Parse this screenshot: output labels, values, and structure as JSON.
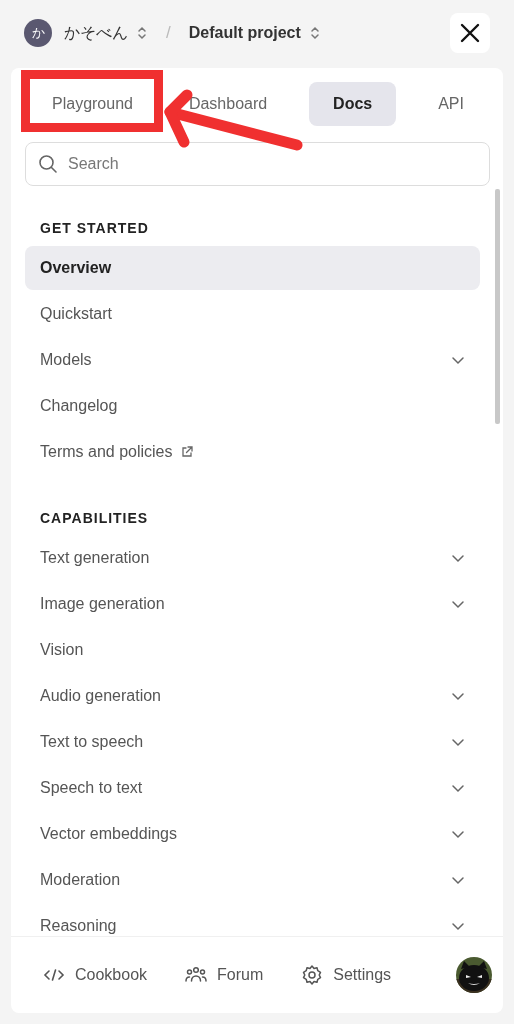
{
  "header": {
    "org_initial": "か",
    "org_name": "かそべん",
    "separator": "/",
    "project_name": "Default project"
  },
  "tabs": [
    {
      "label": "Playground",
      "selected": false
    },
    {
      "label": "Dashboard",
      "selected": false
    },
    {
      "label": "Docs",
      "selected": true
    },
    {
      "label": "API",
      "selected": false
    }
  ],
  "search": {
    "placeholder": "Search"
  },
  "sections": [
    {
      "heading": "GET STARTED",
      "items": [
        {
          "label": "Overview",
          "kind": "page",
          "selected": true
        },
        {
          "label": "Quickstart",
          "kind": "page",
          "selected": false
        },
        {
          "label": "Models",
          "kind": "group",
          "selected": false
        },
        {
          "label": "Changelog",
          "kind": "page",
          "selected": false
        },
        {
          "label": "Terms and policies",
          "kind": "external",
          "selected": false
        }
      ]
    },
    {
      "heading": "CAPABILITIES",
      "items": [
        {
          "label": "Text generation",
          "kind": "group",
          "selected": false
        },
        {
          "label": "Image generation",
          "kind": "group",
          "selected": false
        },
        {
          "label": "Vision",
          "kind": "page",
          "selected": false
        },
        {
          "label": "Audio generation",
          "kind": "group",
          "selected": false
        },
        {
          "label": "Text to speech",
          "kind": "group",
          "selected": false
        },
        {
          "label": "Speech to text",
          "kind": "group",
          "selected": false
        },
        {
          "label": "Vector embeddings",
          "kind": "group",
          "selected": false
        },
        {
          "label": "Moderation",
          "kind": "group",
          "selected": false
        },
        {
          "label": "Reasoning",
          "kind": "group",
          "selected": false
        }
      ]
    }
  ],
  "footer": [
    {
      "label": "Cookbook",
      "kind": "code"
    },
    {
      "label": "Forum",
      "kind": "people"
    },
    {
      "label": "Settings",
      "kind": "gear"
    }
  ],
  "annotations": [
    {
      "kind": "highlight-box"
    },
    {
      "kind": "arrow"
    }
  ]
}
